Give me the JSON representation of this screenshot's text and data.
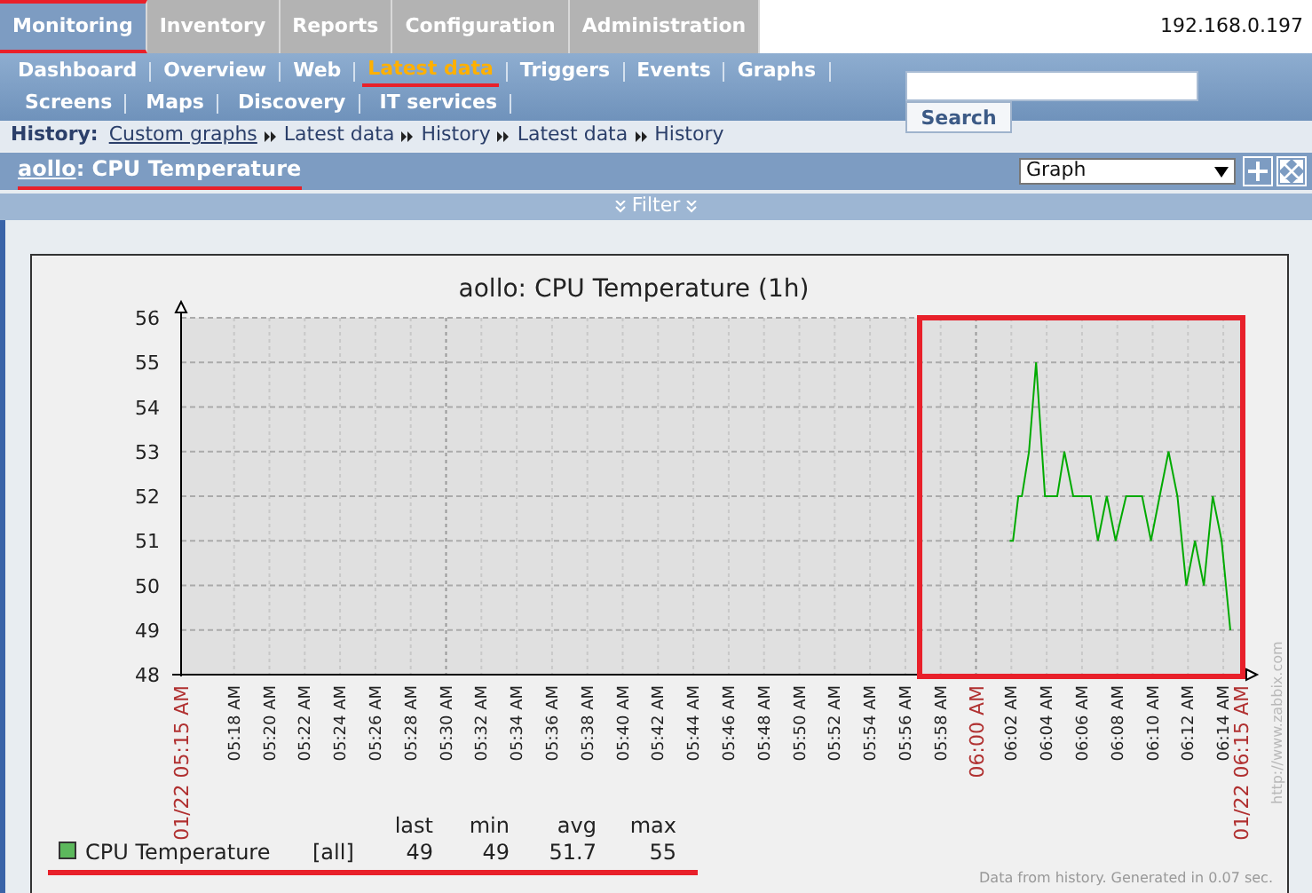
{
  "main_tabs": [
    {
      "label": "Monitoring",
      "selected": true
    },
    {
      "label": "Inventory",
      "selected": false
    },
    {
      "label": "Reports",
      "selected": false
    },
    {
      "label": "Configuration",
      "selected": false
    },
    {
      "label": "Administration",
      "selected": false
    }
  ],
  "server": "192.168.0.197",
  "sub_menu": [
    [
      {
        "label": "Dashboard",
        "selected": false
      },
      {
        "label": "Overview",
        "selected": false
      },
      {
        "label": "Web",
        "selected": false
      },
      {
        "label": "Latest data",
        "selected": true
      },
      {
        "label": "Triggers",
        "selected": false
      },
      {
        "label": "Events",
        "selected": false
      },
      {
        "label": "Graphs",
        "selected": false
      }
    ],
    [
      {
        "label": "Screens",
        "selected": false
      },
      {
        "label": "Maps",
        "selected": false
      },
      {
        "label": "Discovery",
        "selected": false
      },
      {
        "label": "IT services",
        "selected": false
      }
    ]
  ],
  "search": {
    "button": "Search"
  },
  "history": {
    "label": "History:",
    "items": [
      "Custom graphs",
      "Latest data",
      "History",
      "Latest data",
      "History"
    ]
  },
  "header": {
    "host": "aollo",
    "title": ": CPU Temperature",
    "view_select": "Graph"
  },
  "filter": {
    "label": "Filter"
  },
  "graph": {
    "watermark": "http://www.zabbix.com",
    "footer": "Data from history. Generated in 0.07 sec.",
    "chart_data": {
      "type": "line",
      "grid": true,
      "title": "aollo: CPU Temperature (1h)",
      "x": [
        361.9,
        362.1,
        362.4,
        362.6,
        363.0,
        363.4,
        363.9,
        364.6,
        365.0,
        365.5,
        366.5,
        366.9,
        367.4,
        367.9,
        368.5,
        369.4,
        369.9,
        370.4,
        370.9,
        371.4,
        371.9,
        372.4,
        372.9,
        373.4,
        373.9,
        374.4
      ],
      "series": [
        {
          "name": "CPU Temperature",
          "color": "#00aa00",
          "values": [
            51,
            51,
            52,
            52,
            53,
            55,
            52,
            52,
            53,
            52,
            52,
            51,
            52,
            51,
            52,
            52,
            51,
            52,
            53,
            52,
            50,
            51,
            50,
            52,
            51,
            49
          ]
        }
      ],
      "xlim": [
        315,
        375
      ],
      "ylim": [
        48,
        56
      ],
      "yticks": [
        48,
        49,
        50,
        51,
        52,
        53,
        54,
        55,
        56
      ],
      "xticks": [
        {
          "value": 315,
          "label": "01/22 05:15 AM"
        },
        {
          "value": 318,
          "label": "05:18 AM"
        },
        {
          "value": 320,
          "label": "05:20 AM"
        },
        {
          "value": 322,
          "label": "05:22 AM"
        },
        {
          "value": 324,
          "label": "05:24 AM"
        },
        {
          "value": 326,
          "label": "05:26 AM"
        },
        {
          "value": 328,
          "label": "05:28 AM"
        },
        {
          "value": 330,
          "label": "05:30 AM"
        },
        {
          "value": 332,
          "label": "05:32 AM"
        },
        {
          "value": 334,
          "label": "05:34 AM"
        },
        {
          "value": 336,
          "label": "05:36 AM"
        },
        {
          "value": 338,
          "label": "05:38 AM"
        },
        {
          "value": 340,
          "label": "05:40 AM"
        },
        {
          "value": 342,
          "label": "05:42 AM"
        },
        {
          "value": 344,
          "label": "05:44 AM"
        },
        {
          "value": 346,
          "label": "05:46 AM"
        },
        {
          "value": 348,
          "label": "05:48 AM"
        },
        {
          "value": 350,
          "label": "05:50 AM"
        },
        {
          "value": 352,
          "label": "05:52 AM"
        },
        {
          "value": 354,
          "label": "05:54 AM"
        },
        {
          "value": 356,
          "label": "05:56 AM"
        },
        {
          "value": 358,
          "label": "05:58 AM"
        },
        {
          "value": 360,
          "label": "06:00 AM"
        },
        {
          "value": 362,
          "label": "06:02 AM"
        },
        {
          "value": 364,
          "label": "06:04 AM"
        },
        {
          "value": 366,
          "label": "06:06 AM"
        },
        {
          "value": 368,
          "label": "06:08 AM"
        },
        {
          "value": 370,
          "label": "06:10 AM"
        },
        {
          "value": 372,
          "label": "06:12 AM"
        },
        {
          "value": 374,
          "label": "06:14 AM"
        },
        {
          "value": 375,
          "label": "01/22 06:15 AM"
        }
      ]
    },
    "legend": {
      "columns": [
        "last",
        "min",
        "avg",
        "max"
      ],
      "items": [
        {
          "color": "#5cb85c",
          "scope": "[all]",
          "values": [
            "49",
            "49",
            "51.7",
            "55"
          ]
        }
      ]
    }
  }
}
